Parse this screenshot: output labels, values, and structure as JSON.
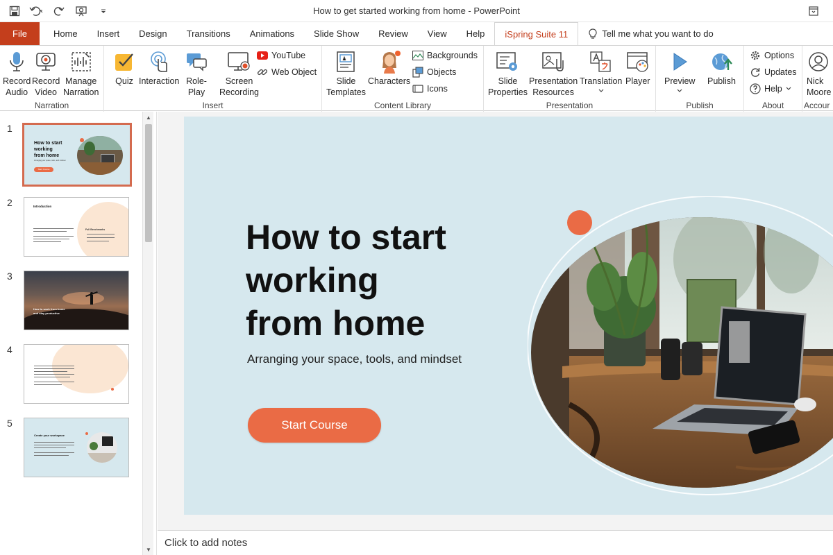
{
  "window": {
    "title": "How to get started working from home  -  PowerPoint"
  },
  "tabs": [
    {
      "label": "File"
    },
    {
      "label": "Home"
    },
    {
      "label": "Insert"
    },
    {
      "label": "Design"
    },
    {
      "label": "Transitions"
    },
    {
      "label": "Animations"
    },
    {
      "label": "Slide Show"
    },
    {
      "label": "Review"
    },
    {
      "label": "View"
    },
    {
      "label": "Help"
    },
    {
      "label": "iSpring Suite 11"
    }
  ],
  "tell_me": "Tell me what you want to do",
  "ribbon": {
    "narration": {
      "label": "Narration",
      "record_audio": "Record\nAudio",
      "record_video": "Record\nVideo",
      "manage_narration": "Manage\nNarration"
    },
    "insert": {
      "label": "Insert",
      "quiz": "Quiz",
      "interaction": "Interaction",
      "role_play": "Role-\nPlay",
      "screen_recording": "Screen\nRecording",
      "youtube": "YouTube",
      "web_object": "Web Object"
    },
    "content_library": {
      "label": "Content Library",
      "slide_templates": "Slide\nTemplates",
      "characters": "Characters",
      "backgrounds": "Backgrounds",
      "objects": "Objects",
      "icons": "Icons"
    },
    "presentation": {
      "label": "Presentation",
      "slide_properties": "Slide\nProperties",
      "presentation_resources": "Presentation\nResources",
      "translation": "Translation",
      "player": "Player"
    },
    "publish": {
      "label": "Publish",
      "preview": "Preview",
      "publish": "Publish"
    },
    "about": {
      "label": "About",
      "options": "Options",
      "updates": "Updates",
      "help": "Help"
    },
    "account": {
      "label": "Accour",
      "name": "Nick\nMoore"
    }
  },
  "thumbnails": [
    {
      "number": "1",
      "title": "How to start\nworking\nfrom home",
      "subtitle": "Arranging your space, tools, and mindset",
      "button": "Start Course"
    },
    {
      "number": "2",
      "title": "Introduction",
      "side_title": "Full Benchmarks"
    },
    {
      "number": "3",
      "title": "How to work from home\nand stay productive"
    },
    {
      "number": "4"
    },
    {
      "number": "5",
      "title": "Create your workspace"
    }
  ],
  "slide": {
    "title": "How to start\nworking\nfrom home",
    "subtitle": "Arranging your space, tools, and mindset",
    "cta": "Start Course"
  },
  "notes_placeholder": "Click to add notes",
  "colors": {
    "file_tab": "#c43e1c",
    "accent": "#ea6b45",
    "slide_bg": "#d6e8ee"
  }
}
